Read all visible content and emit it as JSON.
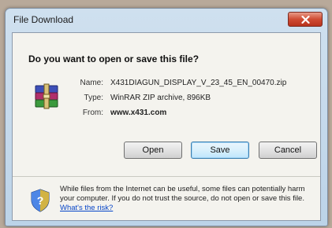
{
  "window": {
    "title": "File Download"
  },
  "dialog": {
    "question": "Do you want to open or save this file?",
    "file": {
      "name_label": "Name:",
      "name_value": "X431DIAGUN_DISPLAY_V_23_45_EN_00470.zip",
      "type_label": "Type:",
      "type_value": "WinRAR ZIP archive, 896KB",
      "from_label": "From:",
      "from_value": "www.x431.com",
      "icon": "winrar-archive-icon"
    },
    "buttons": {
      "open": "Open",
      "save": "Save",
      "cancel": "Cancel"
    },
    "warning": {
      "text": "While files from the Internet can be useful, some files can potentially harm your computer. If you do not trust the source, do not open or save this file.",
      "link": "What's the risk?",
      "icon": "shield-warning-icon"
    }
  },
  "colors": {
    "close_button": "#c9432c",
    "link": "#0645c8",
    "default_button_border": "#3c7fb1"
  }
}
